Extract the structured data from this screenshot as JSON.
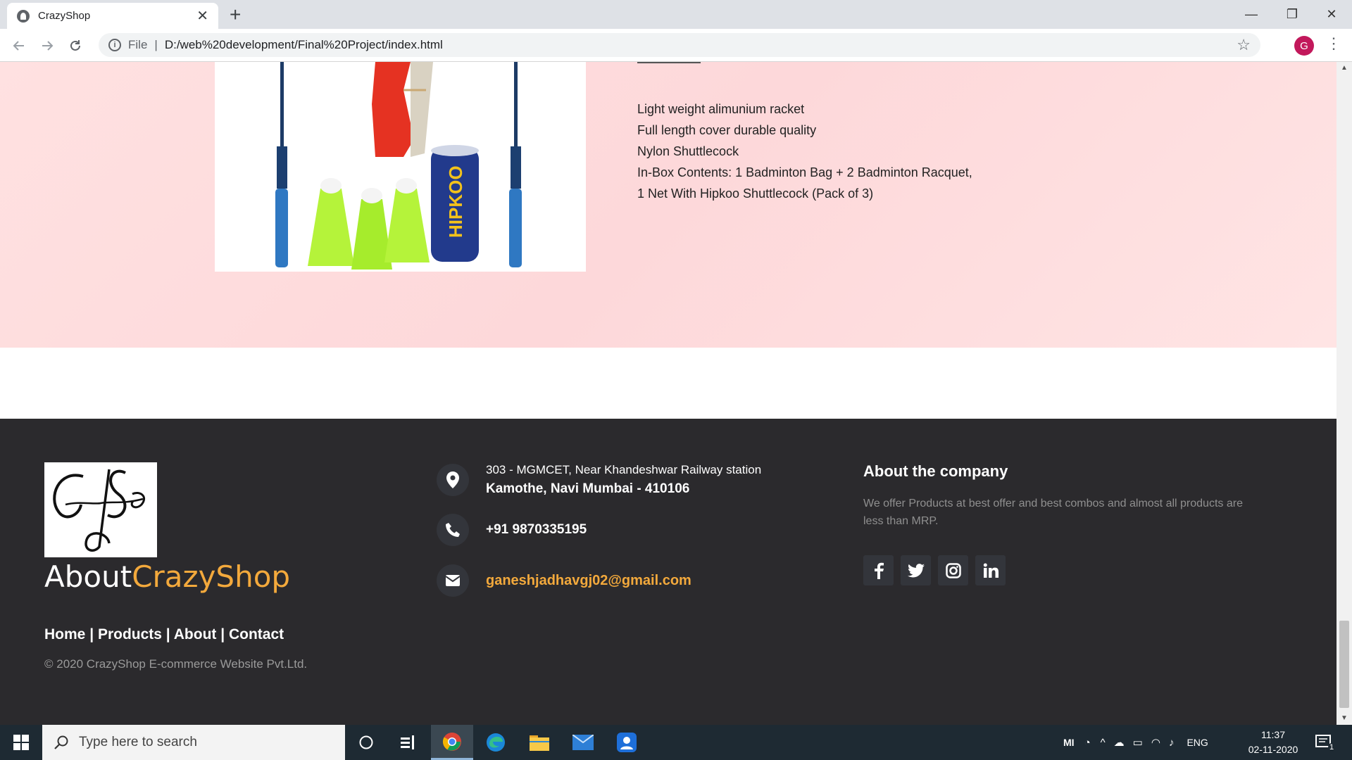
{
  "browser": {
    "tab_title": "CrazyShop",
    "tab_close": "✕",
    "new_tab": "+",
    "address": {
      "scheme_label": "File",
      "url": "D:/web%20development/Final%20Project/index.html"
    },
    "profile_initial": "G",
    "window_controls": {
      "minimize": "—",
      "restore": "❐",
      "close": "✕"
    }
  },
  "product": {
    "features": [
      "Light weight alimunium racket",
      "Full length cover durable quality",
      "Nylon Shuttlecock",
      "In-Box Contents: 1 Badminton Bag + 2 Badminton Racquet,",
      "1 Net With Hipkoo Shuttlecock (Pack of 3)"
    ],
    "image_brand_text": "HIPKOO"
  },
  "footer": {
    "logo_text": "CrazyShop",
    "brand_prefix": "About",
    "brand_accent": "CrazyShop",
    "links": [
      "Home",
      "Products",
      "About",
      "Contact"
    ],
    "link_separator": "|",
    "copyright": "© 2020 CrazyShop E-commerce Website Pvt.Ltd.",
    "address_line1": "303 - MGMCET, Near Khandeshwar Railway station",
    "address_line2": "Kamothe, Navi Mumbai - 410106",
    "phone": "+91 9870335195",
    "email": "ganeshjadhavgj02@gmail.com",
    "about_title": "About the company",
    "about_text": "We offer Products at best offer and best combos and almost all products are less than MRP.",
    "social_icons": [
      "facebook-icon",
      "twitter-icon",
      "instagram-icon",
      "linkedin-icon"
    ]
  },
  "taskbar": {
    "search_placeholder": "Type here to search",
    "language": "ENG",
    "time": "11:37",
    "date": "02-11-2020",
    "notification_count": "1",
    "tray_label": "MI"
  },
  "colors": {
    "accent": "#f3a93c",
    "footer_bg": "#2b2a2d",
    "section_bg": "#fdd8da"
  }
}
